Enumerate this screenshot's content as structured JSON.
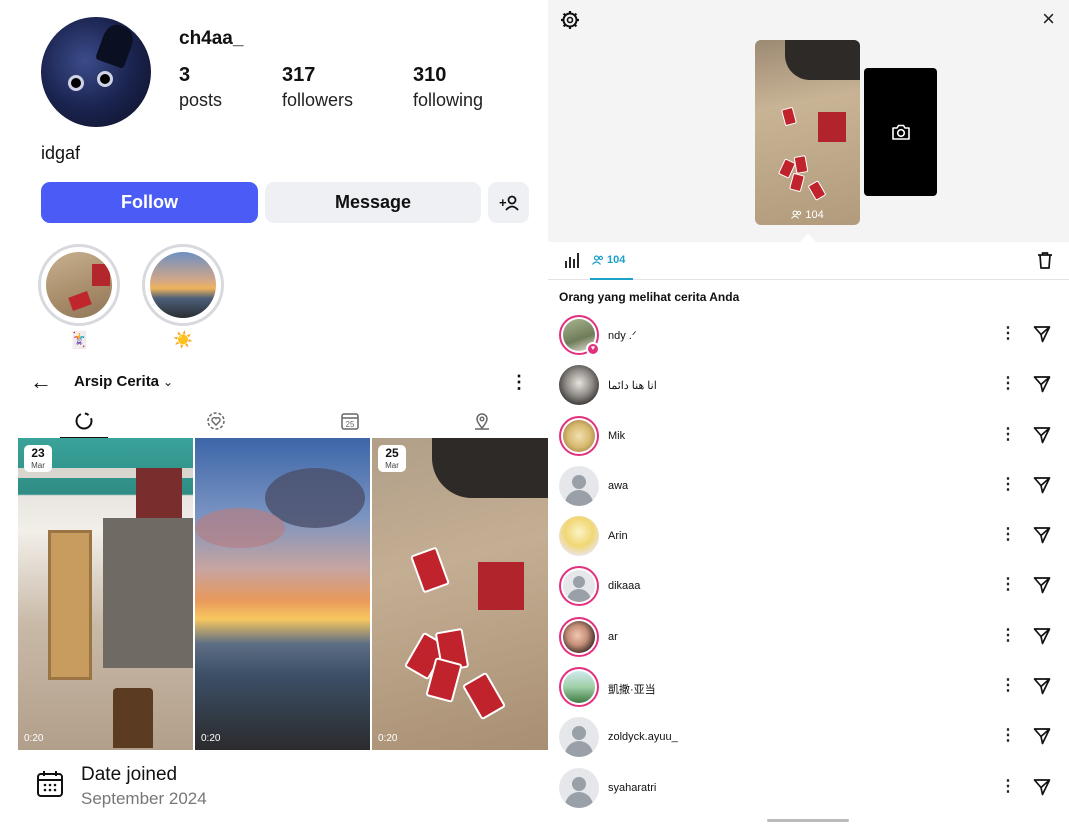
{
  "profile": {
    "username": "ch4aa_",
    "posts_count": "3",
    "posts_label": "posts",
    "followers_count": "317",
    "followers_label": "followers",
    "following_count": "310",
    "following_label": "following",
    "bio": "idgaf",
    "follow_label": "Follow",
    "message_label": "Message"
  },
  "highlights": [
    {
      "emoji": "🃏"
    },
    {
      "emoji": "☀️"
    }
  ],
  "archive": {
    "back": "←",
    "title": "Arsip Cerita",
    "caret": "⌄",
    "more": "⋮",
    "tabs": [
      "stories-icon",
      "memories-icon",
      "calendar-icon",
      "location-icon"
    ],
    "tiles": [
      {
        "day": "23",
        "month": "Mar",
        "duration": "0:20"
      },
      {
        "day": "",
        "month": "",
        "duration": "0:20"
      },
      {
        "day": "25",
        "month": "Mar",
        "duration": "0:20"
      }
    ]
  },
  "joined": {
    "label": "Date joined",
    "value": "September 2024"
  },
  "story_viewer": {
    "close": "×",
    "story_view_count": "104",
    "tab_viewers_count": "104",
    "heading": "Orang yang melihat cerita Anda",
    "viewers": [
      {
        "name": "ndy .ᐟ",
        "avatar": "ring",
        "liked": true
      },
      {
        "name": "انا هنا دائما",
        "avatar": "photo-cat",
        "liked": false
      },
      {
        "name": "Mik",
        "avatar": "ring",
        "liked": false
      },
      {
        "name": "awa",
        "avatar": "default",
        "liked": false
      },
      {
        "name": "Arin",
        "avatar": "photo-anime",
        "liked": false
      },
      {
        "name": "dikaaa",
        "avatar": "ring-default",
        "liked": false
      },
      {
        "name": "ar",
        "avatar": "ring",
        "liked": false
      },
      {
        "name": "凱撒·亚当",
        "avatar": "ring",
        "liked": false
      },
      {
        "name": "zoldyck.ayuu_",
        "avatar": "default",
        "liked": false
      },
      {
        "name": "syaharatri",
        "avatar": "default",
        "liked": false
      }
    ]
  },
  "colors": {
    "follow_button": "#4a5cf5",
    "accent_teal": "#1da1c9",
    "story_ring": "#e2307f"
  }
}
